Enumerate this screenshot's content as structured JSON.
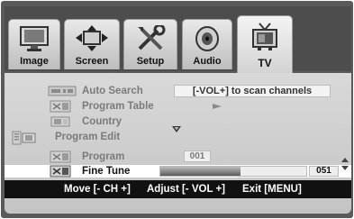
{
  "tabs": [
    {
      "label": "Image",
      "icon": "monitor-icon",
      "active": false
    },
    {
      "label": "Screen",
      "icon": "arrows-icon",
      "active": false
    },
    {
      "label": "Setup",
      "icon": "tools-icon",
      "active": false
    },
    {
      "label": "Audio",
      "icon": "speaker-icon",
      "active": false
    },
    {
      "label": "TV",
      "icon": "tv-icon",
      "active": true
    }
  ],
  "menu": {
    "auto_search": {
      "label": "Auto Search",
      "hint": "[-VOL+] to scan channels"
    },
    "program_table": {
      "label": "Program Table"
    },
    "country": {
      "label": "Country"
    },
    "program_edit": {
      "label": "Program Edit"
    },
    "program": {
      "label": "Program",
      "value": "001"
    },
    "fine_tune": {
      "label": "Fine Tune",
      "value": "051",
      "level_fraction": 0.55
    }
  },
  "footer": {
    "move": "Move [- CH +]",
    "adjust": "Adjust [- VOL +]",
    "exit": "Exit [MENU]"
  },
  "colors": {
    "selected_row": "#ffffff",
    "panel": "#d0d0d0",
    "footer": "#111111",
    "frame": "#5a5a5a"
  }
}
